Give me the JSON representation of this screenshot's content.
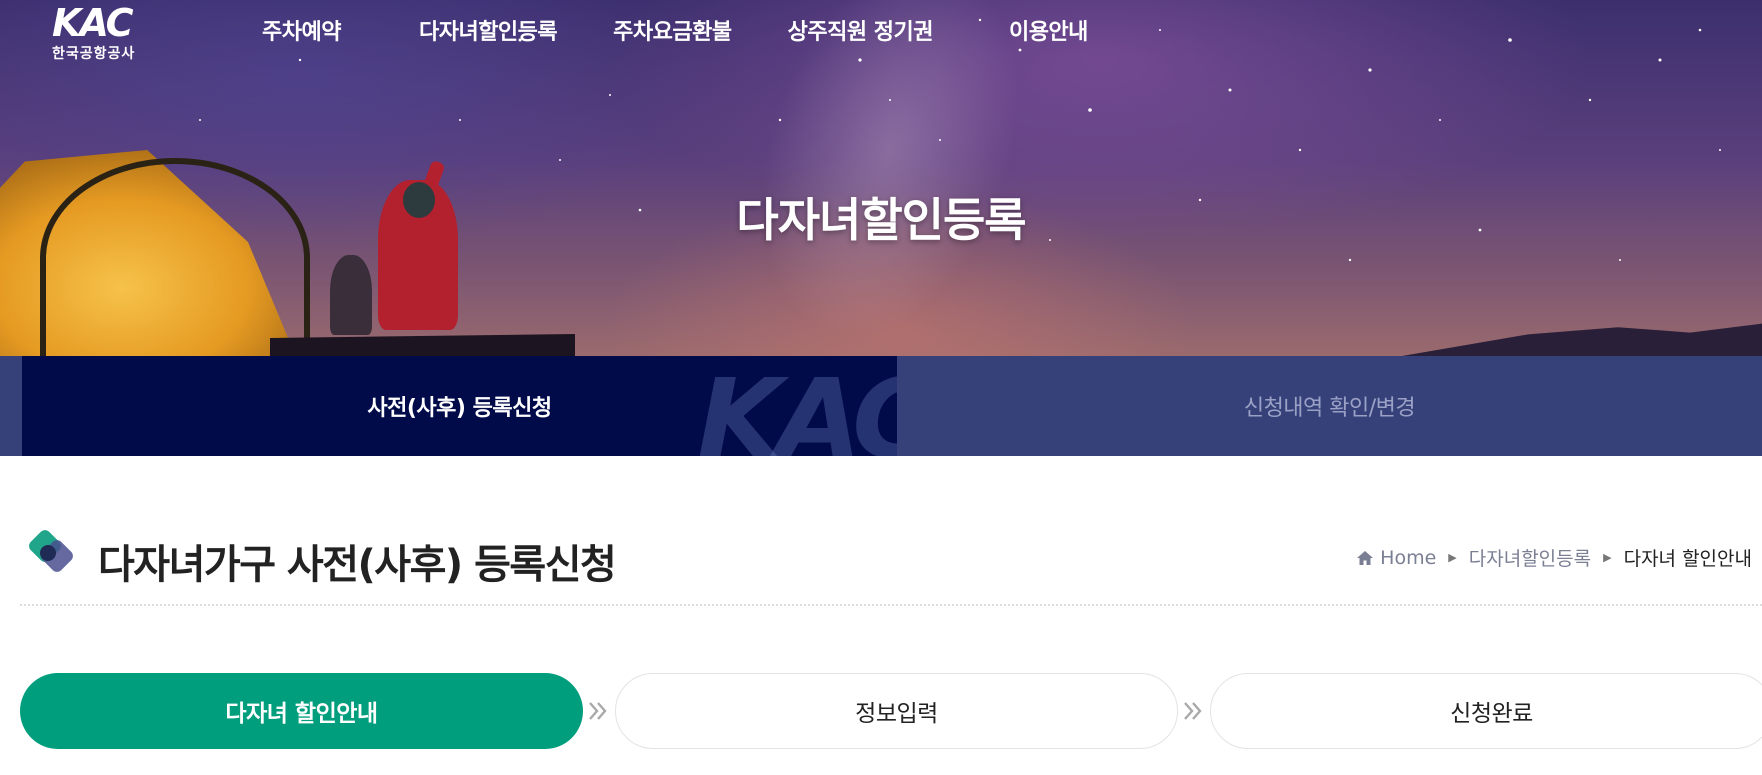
{
  "header": {
    "logo": {
      "mark": "KAC",
      "sub": "한국공항공사"
    },
    "nav": [
      {
        "label": "주차예약"
      },
      {
        "label": "다자녀할인등록"
      },
      {
        "label": "주차요금환불"
      },
      {
        "label": "상주직원 정기권"
      },
      {
        "label": "이용안내"
      }
    ]
  },
  "hero": {
    "title": "다자녀할인등록"
  },
  "subtabs": {
    "active_label": "사전(사후) 등록신청",
    "inactive_label": "신청내역 확인/변경",
    "watermark": "KAC"
  },
  "page": {
    "title": "다자녀가구 사전(사후) 등록신청",
    "breadcrumb": [
      "Home",
      "다자녀할인등록",
      "다자녀 할인안내"
    ]
  },
  "steps": [
    {
      "label": "다자녀 할인안내",
      "state": "active"
    },
    {
      "label": "정보입력",
      "state": "todo"
    },
    {
      "label": "신청완료",
      "state": "todo"
    }
  ],
  "colors": {
    "hero_overlay": "#3c2f6e",
    "tab_active": "#010b4a",
    "tab_inactive": "#36417a",
    "step_active": "#009e7c"
  },
  "icons": [
    "home-icon",
    "title-diamond-icon",
    "step-double-chevron-icon"
  ]
}
